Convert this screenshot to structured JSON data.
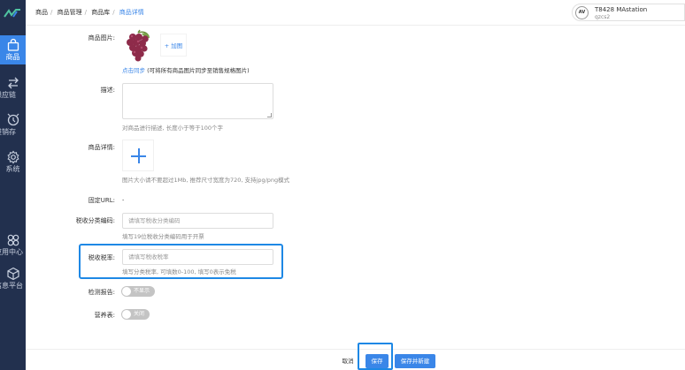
{
  "sidebar": {
    "items": [
      {
        "label": "商品",
        "icon": "bag-icon",
        "active": true
      },
      {
        "label": "供应链",
        "icon": "exchange-icon"
      },
      {
        "label": "进销存",
        "icon": "box-icon"
      },
      {
        "label": "系统",
        "icon": "gear-icon"
      },
      {
        "label": "应用中心",
        "icon": "apps-icon"
      },
      {
        "label": "信息平台",
        "icon": "cube-icon"
      }
    ]
  },
  "breadcrumb": [
    "商品",
    "商品管理",
    "商品库",
    "商品详情"
  ],
  "account": {
    "avatar": "AV",
    "name": "T8428 MAstation",
    "sub": "qzcs2"
  },
  "form": {
    "image_label": "商品图片:",
    "add_image": "+ 加图",
    "sync_link": "点击同步",
    "sync_hint": "(可将所有商品图片同步至销售规格图片)",
    "desc_label": "描述:",
    "desc_hint": "对商品进行描述, 长度小于等于100个字",
    "detail_label": "商品详情:",
    "detail_hint": "图片大小请不要超过1Mb, 推荐尺寸宽度为720, 支持jpg/png模式",
    "url_label": "固定URL:",
    "url_value": "-",
    "tax_code_label": "税收分类编码:",
    "tax_code_placeholder": "请填写税收分类编码",
    "tax_code_hint": "填写19位税收分类编码用于开票",
    "tax_rate_label": "税收税率:",
    "tax_rate_placeholder": "请填写税收税率",
    "tax_rate_hint": "填写分类税率, 可填数0-100, 填写0表示免税",
    "report_label": "检测报告:",
    "report_toggle": "不显示",
    "nutrition_label": "营养表:",
    "nutrition_toggle": "关闭"
  },
  "footer": {
    "cancel": "取消",
    "save": "保存",
    "save_new": "保存并新建"
  },
  "colors": {
    "sidebar": "#22304e",
    "accent": "#3a86e8",
    "highlight": "#1e88e5"
  }
}
